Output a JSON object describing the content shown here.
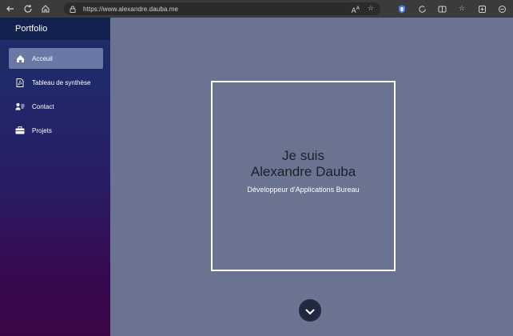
{
  "browser": {
    "url": "https://www.alexandre.dauba.me",
    "icons": [
      "back-icon",
      "refresh-icon",
      "home-icon",
      "lock-icon",
      "read-aloud-icon",
      "favorite-icon",
      "shield-icon",
      "refresh2-icon",
      "split-icon",
      "collections-icon",
      "tab-icon",
      "extensions-icon"
    ]
  },
  "sidebar": {
    "brand": "Portfolio",
    "items": [
      {
        "label": "Acceuil",
        "icon": "home-icon",
        "active": true
      },
      {
        "label": "Tableau de synthèse",
        "icon": "pdf-icon",
        "active": false
      },
      {
        "label": "Contact",
        "icon": "contact-icon",
        "active": false
      },
      {
        "label": "Projets",
        "icon": "briefcase-icon",
        "active": false
      }
    ]
  },
  "hero": {
    "line1": "Je suis",
    "line2": "Alexandre Dauba",
    "subtitle": "Développeur d'Applications Bureau"
  },
  "colors": {
    "main_bg": "#6a7390",
    "active_item": "#6a78a6",
    "brand_bar": "#13214e"
  }
}
